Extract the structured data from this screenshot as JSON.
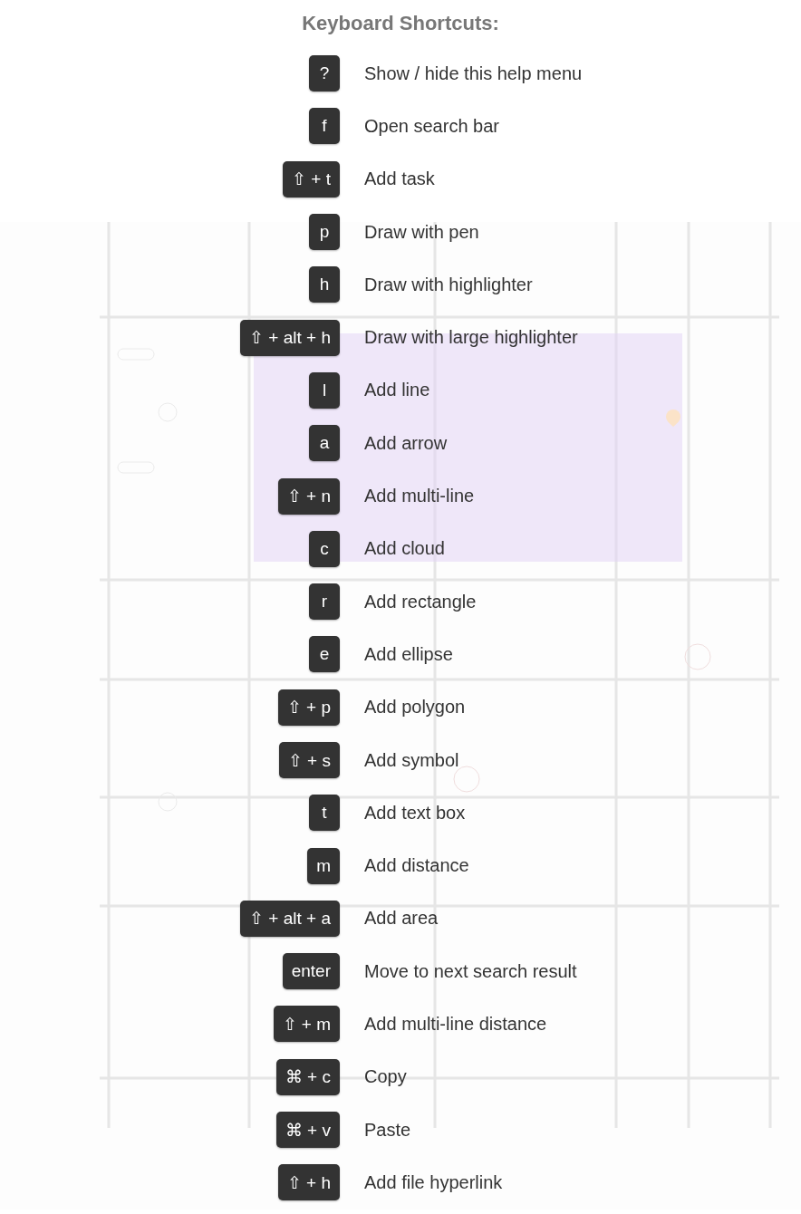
{
  "title": "Keyboard Shortcuts:",
  "shortcuts": [
    {
      "key": "?",
      "action": "Show / hide this help menu"
    },
    {
      "key": "f",
      "action": "Open search bar"
    },
    {
      "key": "⇧ + t",
      "action": "Add task"
    },
    {
      "key": "p",
      "action": "Draw with pen"
    },
    {
      "key": "h",
      "action": "Draw with highlighter"
    },
    {
      "key": "⇧ + alt + h",
      "action": "Draw with large highlighter"
    },
    {
      "key": "l",
      "action": "Add line"
    },
    {
      "key": "a",
      "action": "Add arrow"
    },
    {
      "key": "⇧ + n",
      "action": "Add multi-line"
    },
    {
      "key": "c",
      "action": "Add cloud"
    },
    {
      "key": "r",
      "action": "Add rectangle"
    },
    {
      "key": "e",
      "action": "Add ellipse"
    },
    {
      "key": "⇧ + p",
      "action": "Add polygon"
    },
    {
      "key": "⇧ + s",
      "action": "Add symbol"
    },
    {
      "key": "t",
      "action": "Add text box"
    },
    {
      "key": "m",
      "action": "Add distance"
    },
    {
      "key": "⇧ + alt + a",
      "action": "Add area"
    },
    {
      "key": "enter",
      "action": "Move to next search result"
    },
    {
      "key": "⇧ + m",
      "action": "Add multi-line distance"
    },
    {
      "key": "⌘ + c",
      "action": "Copy"
    },
    {
      "key": "⌘ + v",
      "action": "Paste"
    },
    {
      "key": "⇧ + h",
      "action": "Add file hyperlink"
    }
  ]
}
